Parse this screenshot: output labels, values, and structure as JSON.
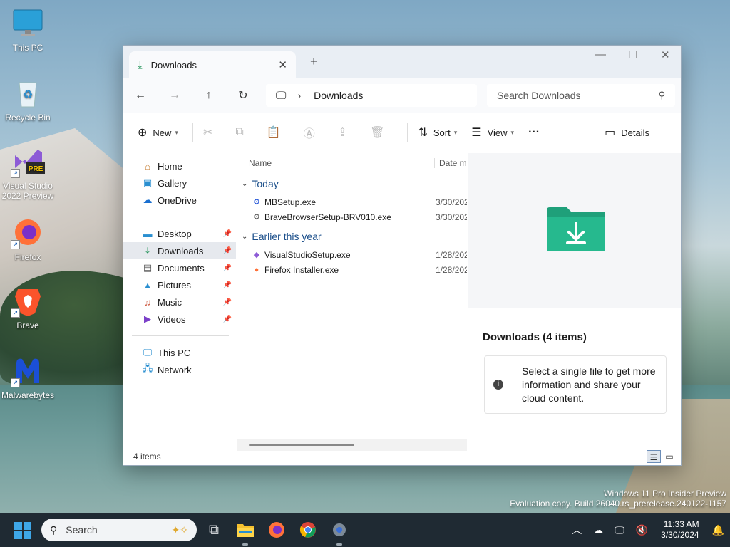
{
  "desktop": {
    "icons": [
      {
        "label": "This PC"
      },
      {
        "label": "Recycle Bin"
      },
      {
        "label": "Visual Studio 2022 Preview",
        "badge": "PRE"
      },
      {
        "label": "Firefox"
      },
      {
        "label": "Brave"
      },
      {
        "label": "Malwarebytes"
      }
    ],
    "watermark": {
      "line1": "Windows 11 Pro Insider Preview",
      "line2": "Evaluation copy. Build 26040.rs_prerelease.240122-1157"
    }
  },
  "window": {
    "tab_title": "Downloads",
    "address": {
      "crumb": "Downloads"
    },
    "search": {
      "placeholder": "Search Downloads"
    },
    "toolbar": {
      "new_label": "New",
      "sort_label": "Sort",
      "view_label": "View",
      "more_label": "···",
      "details_label": "Details"
    },
    "sidebar": {
      "top": [
        {
          "label": "Home",
          "icon": "home-icon"
        },
        {
          "label": "Gallery",
          "icon": "gallery-icon"
        },
        {
          "label": "OneDrive",
          "icon": "cloud-icon"
        }
      ],
      "pinned": [
        {
          "label": "Desktop",
          "icon": "desktop-folder-icon"
        },
        {
          "label": "Downloads",
          "icon": "download-icon",
          "selected": true
        },
        {
          "label": "Documents",
          "icon": "documents-icon"
        },
        {
          "label": "Pictures",
          "icon": "pictures-icon"
        },
        {
          "label": "Music",
          "icon": "music-icon"
        },
        {
          "label": "Videos",
          "icon": "videos-icon"
        }
      ],
      "bottom": [
        {
          "label": "This PC",
          "icon": "pc-icon"
        },
        {
          "label": "Network",
          "icon": "network-icon"
        }
      ]
    },
    "filelist": {
      "columns": {
        "name": "Name",
        "date": "Date mo"
      },
      "groups": [
        {
          "label": "Today",
          "files": [
            {
              "name": "MBSetup.exe",
              "date": "3/30/202"
            },
            {
              "name": "BraveBrowserSetup-BRV010.exe",
              "date": "3/30/202"
            }
          ]
        },
        {
          "label": "Earlier this year",
          "files": [
            {
              "name": "VisualStudioSetup.exe",
              "date": "1/28/202"
            },
            {
              "name": "Firefox Installer.exe",
              "date": "1/28/202"
            }
          ]
        }
      ]
    },
    "details_pane": {
      "title": "Downloads (4 items)",
      "info": "Select a single file to get more information and share your cloud content."
    },
    "status": "4 items"
  },
  "taskbar": {
    "search_placeholder": "Search",
    "time": "11:33 AM",
    "date": "3/30/2024"
  },
  "colors": {
    "accent": "#0f8a4a",
    "taskbar": "#1f2a33",
    "start": "#3ea7e8"
  }
}
